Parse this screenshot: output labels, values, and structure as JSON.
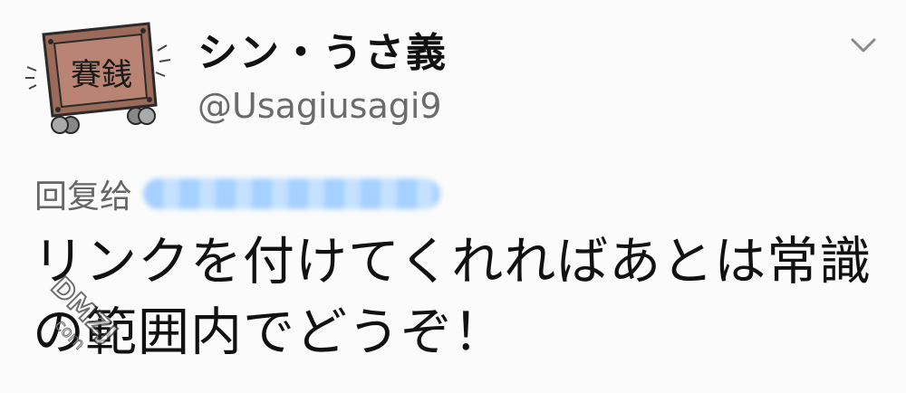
{
  "tweet": {
    "display_name": "シン・うさ義",
    "handle": "@Usagiusagi9",
    "reply_label": "回复给",
    "text": "リンクを付けてくれればあとは常識の範囲内でどうぞ！"
  },
  "avatar": {
    "sign_text": "賽銭"
  },
  "icons": {
    "menu": "chevron-down-icon"
  },
  "watermark": {
    "text_main": "DMZJ",
    "text_sub": "com"
  },
  "colors": {
    "background": "#fbfbfb",
    "name": "#111111",
    "handle": "#6b6b6b",
    "reply_blur": "#cfe5ff"
  }
}
